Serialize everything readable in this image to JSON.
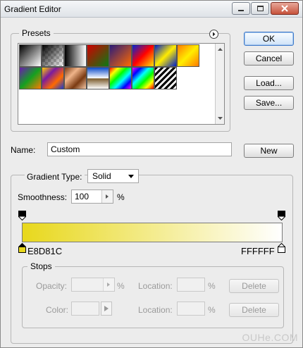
{
  "window": {
    "title": "Gradient Editor",
    "controls": [
      "minimize",
      "maximize",
      "close"
    ]
  },
  "buttons": {
    "ok": "OK",
    "cancel": "Cancel",
    "load": "Load...",
    "save": "Save...",
    "new": "New"
  },
  "presets": {
    "label": "Presets",
    "menu_icon": "arrow-right-circle-icon",
    "swatches": [
      {
        "name": "foreground-to-background",
        "css": "linear-gradient(135deg,#000 0%,#fff 100%)"
      },
      {
        "name": "foreground-to-transparent",
        "css": "linear-gradient(135deg,#000 0%,rgba(0,0,0,0) 100%)"
      },
      {
        "name": "black-white",
        "css": "linear-gradient(90deg,#000,#fff)"
      },
      {
        "name": "red-green",
        "css": "linear-gradient(135deg,#d10000,#0a7a13)"
      },
      {
        "name": "violet-orange",
        "css": "linear-gradient(135deg,#2a1b7a,#ff6a00)"
      },
      {
        "name": "blue-red-yellow",
        "css": "linear-gradient(135deg,#0025d8,#ff0000,#ffe400)"
      },
      {
        "name": "blue-yellow-blue",
        "css": "linear-gradient(135deg,#0020c8,#ffec00,#0020c8)"
      },
      {
        "name": "orange-yellow-orange",
        "css": "linear-gradient(135deg,#ff7a00,#ffee00,#ff7a00)"
      },
      {
        "name": "violet-green-orange",
        "css": "linear-gradient(135deg,#6a1bb0,#14a020,#ff7a00)"
      },
      {
        "name": "yellow-violet-orange-blue",
        "css": "linear-gradient(135deg,#ffd000,#7a1ba0,#ff6a00,#1a3ad0)"
      },
      {
        "name": "copper",
        "css": "linear-gradient(135deg,#7a3a12,#f0b48a,#7a3a12,#f5c9a8)"
      },
      {
        "name": "chrome",
        "css": "linear-gradient(180deg,#0a4ac8,#fff 50%,#7a5a2a 52%,#fff)"
      },
      {
        "name": "spectrum",
        "css": "linear-gradient(135deg,#ff0000,#ffff00,#00ff00,#00ffff,#0000ff,#ff00ff)"
      },
      {
        "name": "transparent-rainbow",
        "css": "linear-gradient(135deg,#ff00ff,#0000ff,#00ffff,#00ff00,#ffff00,#ff0000)"
      },
      {
        "name": "transparent-stripes",
        "css": "repeating-linear-gradient(135deg,#000 0 3px,#fff 3px 6px)"
      }
    ]
  },
  "name_field": {
    "label": "Name:",
    "value": "Custom"
  },
  "gradient_type": {
    "label": "Gradient Type:",
    "value": "Solid"
  },
  "smoothness": {
    "label": "Smoothness:",
    "value": "100",
    "unit": "%"
  },
  "gradient": {
    "start_color": "#E8D81C",
    "end_color": "#FFFFFF",
    "start_label": "E8D81C",
    "end_label": "FFFFFF"
  },
  "stops": {
    "label": "Stops",
    "opacity_label": "Opacity:",
    "opacity_unit": "%",
    "color_label": "Color:",
    "location_label": "Location:",
    "location_unit": "%",
    "delete_label": "Delete"
  },
  "watermark": "OUHe.COM"
}
